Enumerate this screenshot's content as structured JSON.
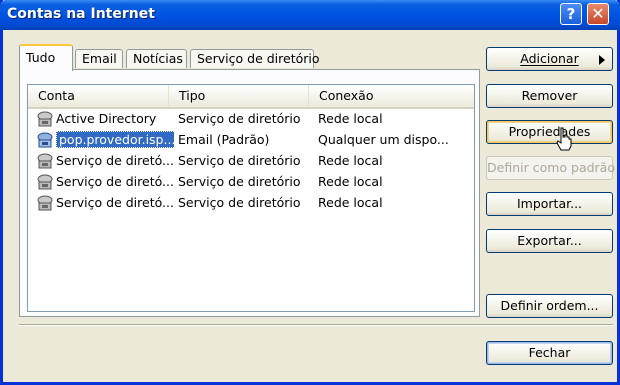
{
  "window": {
    "title": "Contas na Internet"
  },
  "title_buttons": {
    "help": "?",
    "close": "✕"
  },
  "tabs": [
    {
      "label": "Tudo",
      "active": true
    },
    {
      "label": "Email",
      "active": false
    },
    {
      "label": "Notícias",
      "active": false
    },
    {
      "label": "Serviço de diretório",
      "active": false
    }
  ],
  "columns": [
    "Conta",
    "Tipo",
    "Conexão"
  ],
  "rows": [
    {
      "account": "Active Directory",
      "type": "Serviço de diretório",
      "connection": "Rede local",
      "icon": "directory-service-icon",
      "selected": false
    },
    {
      "account": "pop.provedor.isp...",
      "type": "Email (Padrão)",
      "connection": "Qualquer um dispo...",
      "icon": "mail-account-icon",
      "selected": true
    },
    {
      "account": "Serviço de diretó...",
      "type": "Serviço de diretório",
      "connection": "Rede local",
      "icon": "directory-service-icon",
      "selected": false
    },
    {
      "account": "Serviço de diretó...",
      "type": "Serviço de diretório",
      "connection": "Rede local",
      "icon": "directory-service-icon",
      "selected": false
    },
    {
      "account": "Serviço de diretó...",
      "type": "Serviço de diretório",
      "connection": "Rede local",
      "icon": "directory-service-icon",
      "selected": false
    }
  ],
  "buttons": {
    "add": "Adicionar",
    "remove": "Remover",
    "properties": "Propriedades",
    "set_default": "Definir como padrão",
    "import": "Importar...",
    "export": "Exportar...",
    "set_order": "Definir ordem...",
    "close": "Fechar"
  },
  "colors": {
    "titlebar": "#0054e3",
    "selection": "#316ac5",
    "face": "#ece9d8"
  }
}
